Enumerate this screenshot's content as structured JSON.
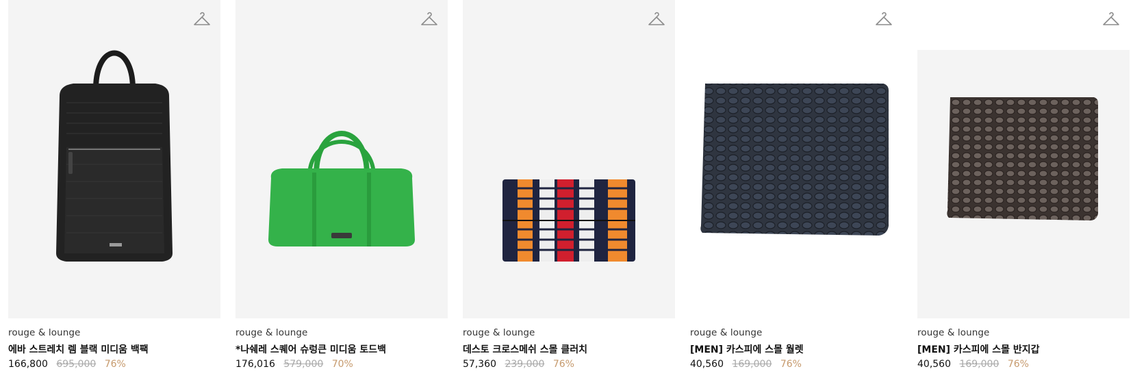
{
  "colors": {
    "card_background": "#f4f4f4",
    "discount": "#c69a6d",
    "original_price": "#a9a9a9"
  },
  "products": [
    {
      "brand": "rouge & lounge",
      "name": "에바 스트레치 렘 블랙 미디움 백팩",
      "price": "166,800",
      "original_price": "695,000",
      "discount": "76%",
      "image": "black-backpack"
    },
    {
      "brand": "rouge & lounge",
      "name": "*나쉐레 스퀘어 슈렁큰 미디움 토드백",
      "price": "176,016",
      "original_price": "579,000",
      "discount": "70%",
      "image": "green-tote-bag"
    },
    {
      "brand": "rouge & lounge",
      "name": "데스토 크로스메쉬 스몰 클러치",
      "price": "57,360",
      "original_price": "239,000",
      "discount": "76%",
      "image": "striped-woven-clutch"
    },
    {
      "brand": "rouge & lounge",
      "name": "[MEN] 카스피에 스몰 월렛",
      "price": "40,560",
      "original_price": "169,000",
      "discount": "76%",
      "image": "navy-croc-wallet"
    },
    {
      "brand": "rouge & lounge",
      "name": "[MEN] 카스피에 스몰 반지갑",
      "price": "40,560",
      "original_price": "169,000",
      "discount": "76%",
      "image": "brown-croc-wallet"
    }
  ],
  "icons": {
    "wishlist": "hanger-icon"
  }
}
